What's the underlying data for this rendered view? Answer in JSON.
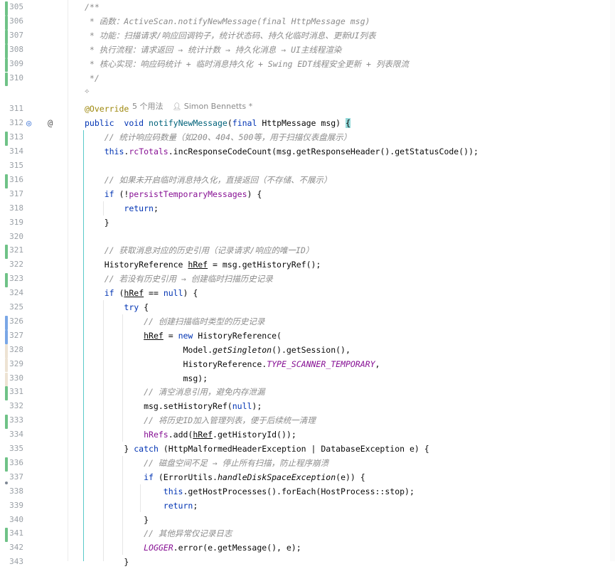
{
  "hints": {
    "ai_icon": "ai-sparkle-icon",
    "usages": "5 个用法",
    "author": "Simon Bennetts *"
  },
  "lines": [
    {
      "n": "305",
      "change": "green",
      "t": [
        [
          "cm",
          "/**"
        ]
      ]
    },
    {
      "n": "306",
      "change": "green",
      "t": [
        [
          "cm",
          " * 函数：ActiveScan.notifyNewMessage(final HttpMessage msg)"
        ]
      ]
    },
    {
      "n": "307",
      "change": "green",
      "t": [
        [
          "cm",
          " * 功能：扫描请求/响应回调钩子，统计状态码、持久化临时消息、更新UI列表"
        ]
      ]
    },
    {
      "n": "308",
      "change": "green",
      "t": [
        [
          "cm",
          " * 执行流程：请求返回 → 统计计数 → 持久化消息 → UI主线程渲染"
        ]
      ]
    },
    {
      "n": "309",
      "change": "green",
      "t": [
        [
          "cm",
          " * 核心实现：响应码统计 + 临时消息持久化 + Swing EDT线程安全更新 + 列表限流"
        ]
      ]
    },
    {
      "n": "310",
      "change": "green",
      "t": [
        [
          "cm",
          " */"
        ]
      ]
    },
    {
      "n": "311",
      "t": [
        [
          "ann",
          "@Override"
        ]
      ]
    },
    {
      "n": "312",
      "t": [
        [
          "kw",
          "public"
        ],
        [
          "",
          "  "
        ],
        [
          "kw",
          "void"
        ],
        [
          "",
          " "
        ],
        [
          "fn",
          "notifyNewMessage"
        ],
        [
          "",
          "("
        ],
        [
          "kw",
          "final"
        ],
        [
          "",
          " HttpMessage msg) "
        ],
        [
          "hl",
          "{"
        ]
      ]
    },
    {
      "n": "313",
      "change": "green",
      "t": [
        [
          "",
          "    "
        ],
        [
          "cm",
          "// 统计响应码数量（如200、404、500等，用于扫描仪表盘展示）"
        ]
      ]
    },
    {
      "n": "314",
      "t": [
        [
          "",
          "    "
        ],
        [
          "kw",
          "this"
        ],
        [
          "",
          "."
        ],
        [
          "fld",
          "rcTotals"
        ],
        [
          "",
          ".incResponseCodeCount(msg.getResponseHeader().getStatusCode());"
        ]
      ]
    },
    {
      "n": "315",
      "t": []
    },
    {
      "n": "316",
      "change": "green",
      "t": [
        [
          "",
          "    "
        ],
        [
          "cm",
          "// 如果未开启临时消息持久化，直接返回（不存储、不展示）"
        ]
      ]
    },
    {
      "n": "317",
      "t": [
        [
          "",
          "    "
        ],
        [
          "kw",
          "if"
        ],
        [
          "",
          " (!"
        ],
        [
          "fld",
          "persistTemporaryMessages"
        ],
        [
          "",
          ") {"
        ]
      ]
    },
    {
      "n": "318",
      "t": [
        [
          "",
          "        "
        ],
        [
          "kw",
          "return"
        ],
        [
          "",
          ";"
        ]
      ]
    },
    {
      "n": "319",
      "t": [
        [
          "",
          "    }"
        ]
      ]
    },
    {
      "n": "320",
      "t": []
    },
    {
      "n": "321",
      "change": "green",
      "t": [
        [
          "",
          "    "
        ],
        [
          "cm",
          "// 获取消息对应的历史引用（记录请求/响应的唯一ID）"
        ]
      ]
    },
    {
      "n": "322",
      "t": [
        [
          "",
          "    HistoryReference "
        ],
        [
          "u",
          "hRef"
        ],
        [
          "",
          " = msg.getHistoryRef();"
        ]
      ]
    },
    {
      "n": "323",
      "change": "green",
      "t": [
        [
          "",
          "    "
        ],
        [
          "cm",
          "// 若没有历史引用 → 创建临时扫描历史记录"
        ]
      ]
    },
    {
      "n": "324",
      "t": [
        [
          "",
          "    "
        ],
        [
          "kw",
          "if"
        ],
        [
          "",
          " ("
        ],
        [
          "u",
          "hRef"
        ],
        [
          "",
          " == "
        ],
        [
          "kw",
          "null"
        ],
        [
          "",
          ") {"
        ]
      ]
    },
    {
      "n": "325",
      "t": [
        [
          "",
          "        "
        ],
        [
          "kw",
          "try"
        ],
        [
          "",
          " {"
        ]
      ]
    },
    {
      "n": "326",
      "change": "blue",
      "t": [
        [
          "",
          "            "
        ],
        [
          "cm",
          "// 创建扫描临时类型的历史记录"
        ]
      ]
    },
    {
      "n": "327",
      "change": "blue",
      "t": [
        [
          "",
          "            "
        ],
        [
          "u",
          "hRef"
        ],
        [
          "",
          " = "
        ],
        [
          "kw",
          "new"
        ],
        [
          "",
          " HistoryReference("
        ]
      ]
    },
    {
      "n": "328",
      "change": "beige",
      "t": [
        [
          "",
          "                    Model."
        ],
        [
          "ital",
          "getSingleton"
        ],
        [
          "",
          "().getSession(),"
        ]
      ]
    },
    {
      "n": "329",
      "change": "beige",
      "t": [
        [
          "",
          "                    HistoryReference."
        ],
        [
          "st",
          "TYPE_SCANNER_TEMPORARY"
        ],
        [
          "",
          ","
        ]
      ]
    },
    {
      "n": "330",
      "change": "beige",
      "t": [
        [
          "",
          "                    msg);"
        ]
      ]
    },
    {
      "n": "331",
      "change": "green",
      "t": [
        [
          "",
          "            "
        ],
        [
          "cm",
          "// 清空消息引用，避免内存泄漏"
        ]
      ]
    },
    {
      "n": "332",
      "t": [
        [
          "",
          "            msg.setHistoryRef("
        ],
        [
          "kw",
          "null"
        ],
        [
          "",
          ");"
        ]
      ]
    },
    {
      "n": "333",
      "change": "green",
      "t": [
        [
          "",
          "            "
        ],
        [
          "cm",
          "// 将历史ID加入管理列表，便于后续统一清理"
        ]
      ]
    },
    {
      "n": "334",
      "t": [
        [
          "",
          "            "
        ],
        [
          "fld",
          "hRefs"
        ],
        [
          "",
          ".add("
        ],
        [
          "u",
          "hRef"
        ],
        [
          "",
          ".getHistoryId());"
        ]
      ]
    },
    {
      "n": "335",
      "t": [
        [
          "",
          "        } "
        ],
        [
          "kw",
          "catch"
        ],
        [
          "",
          " (HttpMalformedHeaderException | DatabaseException e) {"
        ]
      ]
    },
    {
      "n": "336",
      "change": "green",
      "t": [
        [
          "",
          "            "
        ],
        [
          "cm",
          "// 磁盘空间不足 → 停止所有扫描，防止程序崩溃"
        ]
      ]
    },
    {
      "n": "337",
      "t": [
        [
          "",
          "            "
        ],
        [
          "kw",
          "if"
        ],
        [
          "",
          " (ErrorUtils."
        ],
        [
          "ital",
          "handleDiskSpaceException"
        ],
        [
          "",
          "(e)) {"
        ]
      ]
    },
    {
      "n": "338",
      "t": [
        [
          "",
          "                "
        ],
        [
          "kw",
          "this"
        ],
        [
          "",
          ".getHostProcesses().forEach(HostProcess::stop);"
        ]
      ]
    },
    {
      "n": "339",
      "t": [
        [
          "",
          "                "
        ],
        [
          "kw",
          "return"
        ],
        [
          "",
          ";"
        ]
      ]
    },
    {
      "n": "340",
      "t": [
        [
          "",
          "            }"
        ]
      ]
    },
    {
      "n": "341",
      "change": "green",
      "t": [
        [
          "",
          "            "
        ],
        [
          "cm",
          "// 其他异常仅记录日志"
        ]
      ]
    },
    {
      "n": "342",
      "t": [
        [
          "",
          "            "
        ],
        [
          "st",
          "LOGGER"
        ],
        [
          "",
          ".error(e.getMessage(), e);"
        ]
      ]
    },
    {
      "n": "343",
      "t": [
        [
          "",
          "        }"
        ]
      ]
    }
  ],
  "gutter_icons": {
    "override_icon": "override-method-icon",
    "annotation_icon": "annotation-at-icon"
  }
}
